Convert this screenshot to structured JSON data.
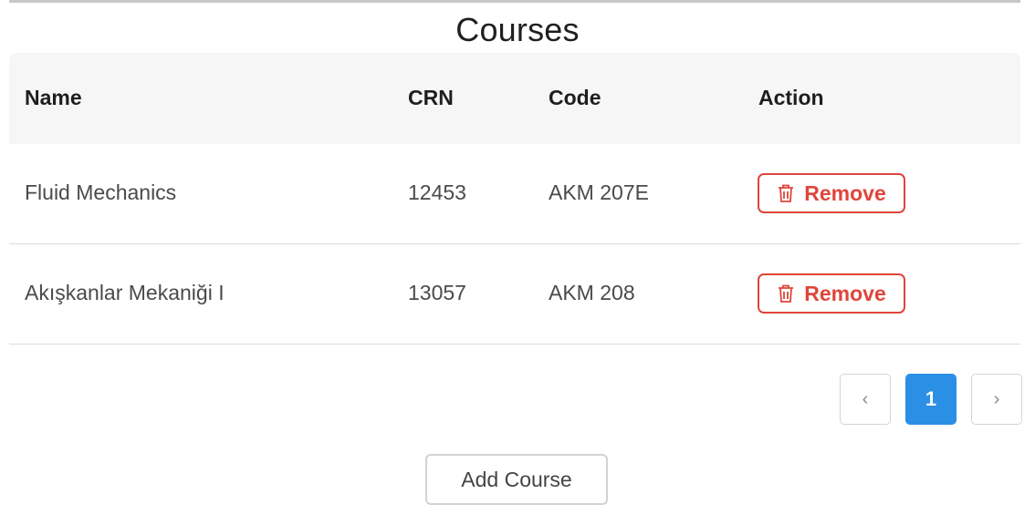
{
  "page": {
    "title": "Courses"
  },
  "table": {
    "headers": {
      "name": "Name",
      "crn": "CRN",
      "code": "Code",
      "action": "Action"
    },
    "rows": [
      {
        "name": "Fluid Mechanics",
        "crn": "12453",
        "code": "AKM 207E",
        "action_label": "Remove"
      },
      {
        "name": "Akışkanlar Mekaniği I",
        "crn": "13057",
        "code": "AKM 208",
        "action_label": "Remove"
      }
    ]
  },
  "pagination": {
    "prev": "‹",
    "current_page": "1",
    "next": "›"
  },
  "actions": {
    "add_course": "Add Course"
  },
  "colors": {
    "danger": "#e0453b",
    "primary": "#2b8fe6",
    "header_bg": "#f6f6f6"
  },
  "icons": {
    "remove": "trash-icon",
    "prev": "chevron-left-icon",
    "next": "chevron-right-icon"
  }
}
